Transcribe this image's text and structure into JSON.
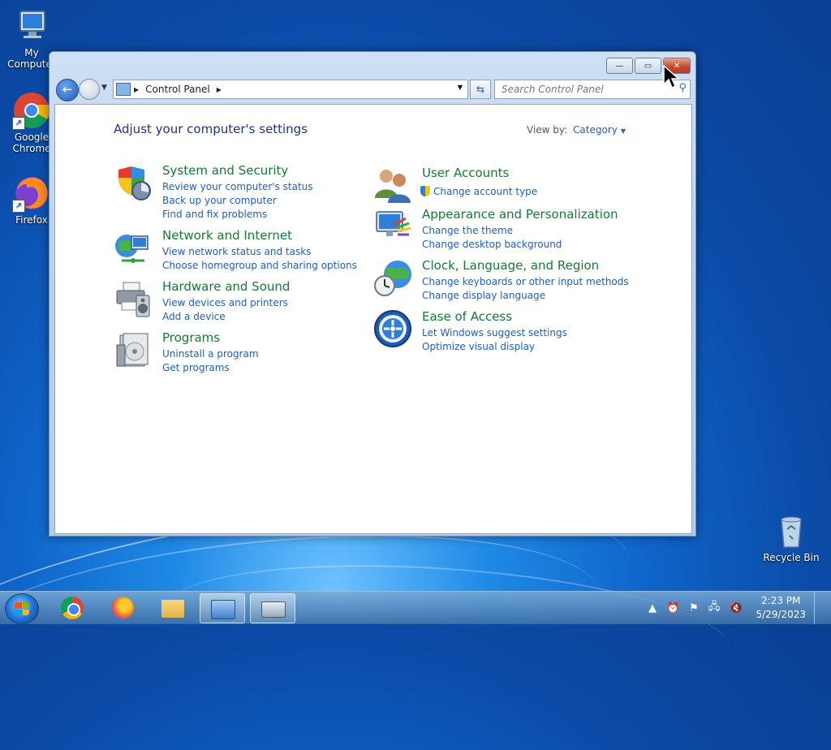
{
  "desktop": {
    "icons": [
      {
        "label": "My Computer",
        "icon": "computer-icon"
      },
      {
        "label": "Google Chrome",
        "icon": "chrome-icon"
      },
      {
        "label": "Firefox",
        "icon": "firefox-icon"
      },
      {
        "label": "Recycle Bin",
        "icon": "recycle-bin-icon"
      }
    ]
  },
  "window": {
    "controls": {
      "minimize": "—",
      "maximize": "▭",
      "close": "✕"
    },
    "address": {
      "segments": [
        "Control Panel"
      ],
      "icon": "control-panel-icon"
    },
    "search": {
      "placeholder": "Search Control Panel"
    },
    "headline": "Adjust your computer's settings",
    "view_by": {
      "label": "View by:",
      "value": "Category"
    },
    "categories_left": [
      {
        "title": "System and Security",
        "icon": "shield-icon",
        "links": [
          "Review your computer's status",
          "Back up your computer",
          "Find and fix problems"
        ]
      },
      {
        "title": "Network and Internet",
        "icon": "network-globe-icon",
        "links": [
          "View network status and tasks",
          "Choose homegroup and sharing options"
        ]
      },
      {
        "title": "Hardware and Sound",
        "icon": "printer-speaker-icon",
        "links": [
          "View devices and printers",
          "Add a device"
        ]
      },
      {
        "title": "Programs",
        "icon": "programs-icon",
        "links": [
          "Uninstall a program",
          "Get programs"
        ]
      }
    ],
    "categories_right": [
      {
        "title": "User Accounts",
        "icon": "users-icon",
        "links": [
          "Change account type"
        ]
      },
      {
        "title": "Appearance and Personalization",
        "icon": "monitor-palette-icon",
        "links": [
          "Change the theme",
          "Change desktop background"
        ]
      },
      {
        "title": "Clock, Language, and Region",
        "icon": "globe-clock-icon",
        "links": [
          "Change keyboards or other input methods",
          "Change display language"
        ]
      },
      {
        "title": "Ease of Access",
        "icon": "ease-of-access-icon",
        "links": [
          "Let Windows suggest settings",
          "Optimize visual display"
        ]
      }
    ]
  },
  "taskbar": {
    "items": [
      "chrome-icon",
      "firefox-icon",
      "file-explorer-icon",
      "control-panel-icon",
      "on-screen-keyboard-icon"
    ],
    "clock": {
      "time": "2:23 PM",
      "date": "5/29/2023"
    }
  }
}
